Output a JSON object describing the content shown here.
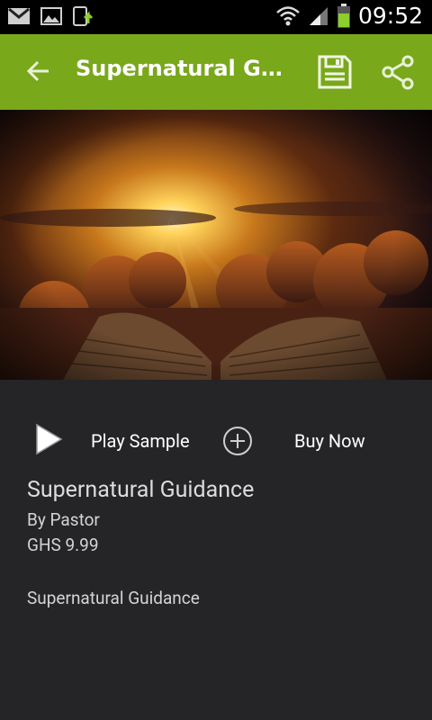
{
  "status_bar": {
    "time": "09:52",
    "icons": [
      "gmail-icon",
      "image-icon",
      "download-update-icon",
      "wifi-icon",
      "signal-icon",
      "battery-icon"
    ]
  },
  "action_bar": {
    "title": "Supernatural Guidance",
    "background_color": "#79a81b",
    "icons": [
      "back-arrow-icon",
      "save-icon",
      "share-icon"
    ]
  },
  "hero": {
    "image_alt": "Sunset over clouds with an open book"
  },
  "controls": {
    "play_label": "Play Sample",
    "buy_label": "Buy Now"
  },
  "details": {
    "title": "Supernatural Guidance",
    "author": "By Pastor",
    "price": "GHS 9.99",
    "description": "Supernatural Guidance"
  }
}
